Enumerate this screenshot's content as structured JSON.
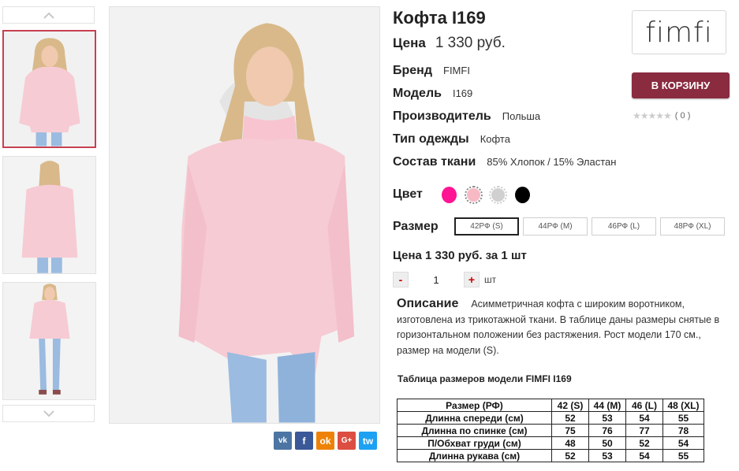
{
  "product": {
    "title": "Кофта I169",
    "price_label": "Цена",
    "price_value": "1 330 руб.",
    "specs": [
      {
        "label": "Бренд",
        "value": "FIMFI"
      },
      {
        "label": "Модель",
        "value": "I169"
      },
      {
        "label": "Производитель",
        "value": "Польша"
      },
      {
        "label": "Тип одежды",
        "value": "Кофта"
      },
      {
        "label": "Состав ткани",
        "value": "85% Хлопок / 15% Эластан"
      }
    ],
    "color_label": "Цвет",
    "colors": [
      {
        "name": "fuchsia",
        "hex": "#ff1493"
      },
      {
        "name": "pink",
        "hex": "#f7b9c4"
      },
      {
        "name": "gray",
        "hex": "#d0d0d0"
      },
      {
        "name": "black",
        "hex": "#000000"
      }
    ],
    "size_label": "Размер",
    "sizes": [
      "42РФ (S)",
      "44РФ (M)",
      "46РФ (L)",
      "48РФ (XL)"
    ],
    "selected_size": "42РФ (S)",
    "unit_price": "Цена 1 330 руб. за 1 шт",
    "quantity": {
      "minus": "-",
      "value": "1",
      "plus": "+",
      "unit": "шт"
    }
  },
  "brand_logo": "fimfi",
  "cart_button": "В КОРЗИНУ",
  "rating": {
    "stars": "★★★★★",
    "count": "( 0 )"
  },
  "description": {
    "heading": "Описание",
    "text": "Асимметричная кофта с широким воротником, изготовлена из трикотажной ткани. В таблице даны размеры снятые в горизонтальном положении без растяжения. Рост модели 170 см., размер на модели (S)."
  },
  "size_table": {
    "title": "Таблица размеров модели FIMFI  I169",
    "header": [
      "Размер (РФ)",
      "42 (S)",
      "44 (M)",
      "46 (L)",
      "48 (XL)"
    ],
    "rows": [
      [
        "Длинна спереди (см)",
        "52",
        "53",
        "54",
        "55"
      ],
      [
        "Длинна по спинке (см)",
        "75",
        "76",
        "77",
        "78"
      ],
      [
        "П/Обхват груди (см)",
        "48",
        "50",
        "52",
        "54"
      ],
      [
        "Длинна рукава (см)",
        "52",
        "53",
        "54",
        "55"
      ]
    ]
  },
  "social": [
    "vk",
    "f",
    "ok",
    "G+",
    "tw"
  ]
}
